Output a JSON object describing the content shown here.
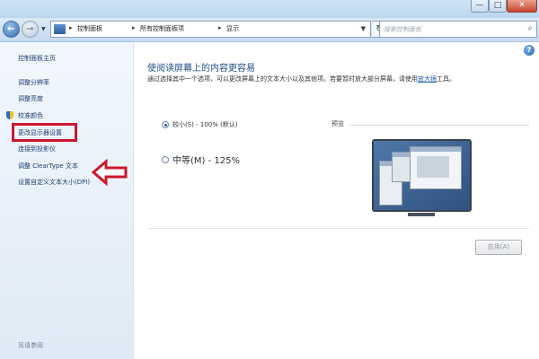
{
  "window": {
    "controls": {
      "minimize": "—",
      "maximize": "□",
      "close": "✕"
    }
  },
  "navbar": {
    "breadcrumbs": [
      "控制面板",
      "所有控制面板项",
      "显示"
    ],
    "search_placeholder": "搜索控制面板",
    "icons": {
      "back": "back-arrow-icon",
      "forward": "forward-arrow-icon",
      "refresh": "refresh-icon",
      "search": "search-icon"
    }
  },
  "sidebar": {
    "home": "控制面板主页",
    "items": [
      "调整分辨率",
      "调整亮度",
      "校准颜色",
      "更改显示器设置",
      "连接到投影仪",
      "调整 ClearType 文本",
      "设置自定义文本大小(DPI)"
    ],
    "bottom": "另请参阅"
  },
  "main": {
    "title": "使阅读屏幕上的内容更容易",
    "description": "通过选择其中一个选项，可以更改屏幕上的文本大小以及其他项。若要暂时放大部分屏幕，请使用",
    "description_link": "放大镜",
    "description_tail": "工具。",
    "options": [
      {
        "label": "较小(S) - 100% (默认)",
        "checked": true
      },
      {
        "label": "中等(M) - 125%",
        "checked": false
      }
    ],
    "preview_label": "预览",
    "apply_label": "应用(A)",
    "help": "?"
  },
  "colors": {
    "highlight": "#c9182f",
    "link": "#1b3f6e",
    "title": "#1f4f8b"
  }
}
